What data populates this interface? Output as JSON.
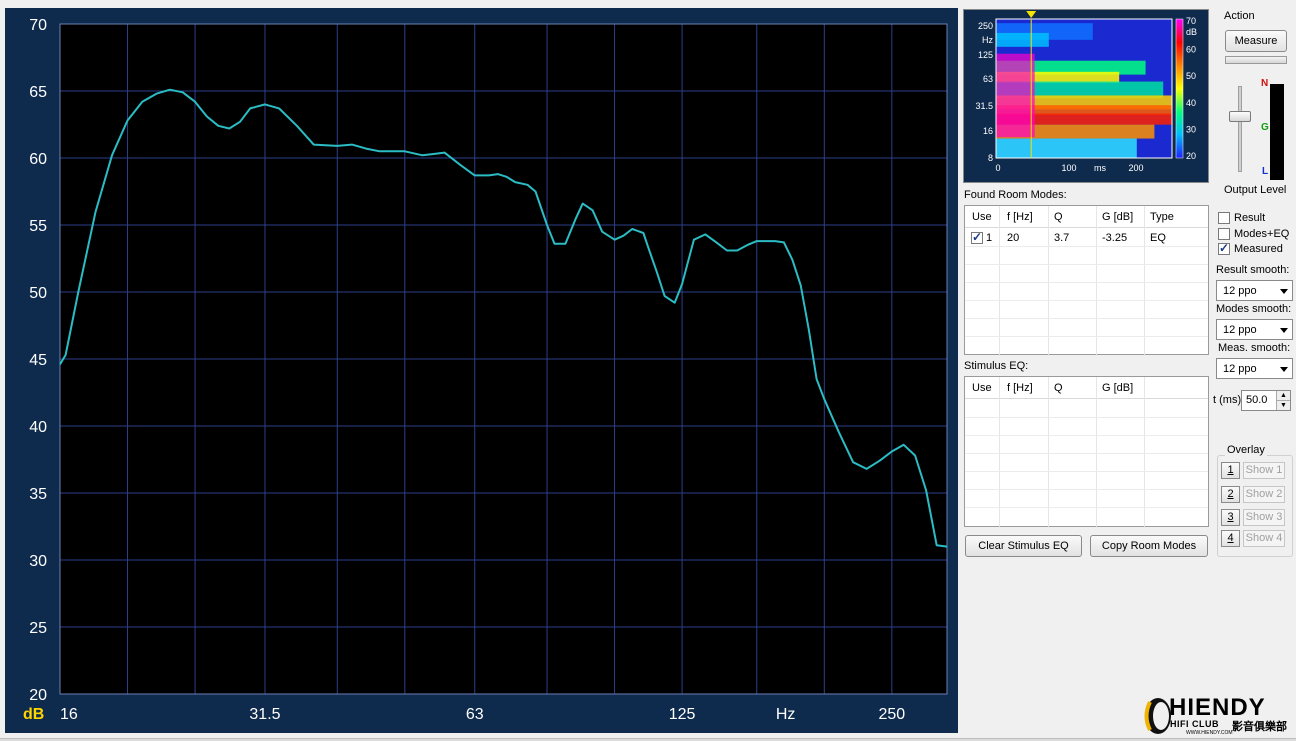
{
  "main_plot": {
    "y_unit_label": "dB",
    "x_unit_label": "Hz",
    "y_tick_labels": [
      "70",
      "65",
      "60",
      "55",
      "50",
      "45",
      "40",
      "35",
      "30",
      "25",
      "20"
    ],
    "x_tick_labels": [
      "16",
      "31.5",
      "63",
      "125",
      "250"
    ],
    "line_color": "#2bbcc4",
    "background_color": "#000000",
    "grid_color": "#2d3f8c"
  },
  "chart_data": {
    "type": "line",
    "xlabel": "Hz",
    "ylabel": "dB",
    "ylim": [
      20,
      70
    ],
    "xlim": [
      16,
      300
    ],
    "x_scale": "log",
    "grid": true,
    "series": [
      {
        "x": [
          16,
          16.3,
          17,
          18,
          19,
          20,
          21,
          22,
          23,
          24,
          25,
          26,
          27,
          28,
          29,
          30,
          31.5,
          33,
          35,
          37,
          40,
          42,
          44,
          46,
          48,
          50,
          53,
          55,
          57,
          60,
          63,
          66,
          68,
          70,
          72,
          75,
          77,
          80,
          82,
          85,
          88,
          90,
          93,
          96,
          100,
          103,
          106,
          110,
          112,
          115,
          118,
          122,
          125,
          130,
          135,
          140,
          145,
          150,
          155,
          160,
          165,
          170,
          175,
          180,
          185,
          190,
          195,
          200,
          210,
          220,
          230,
          240,
          250,
          260,
          270,
          280,
          290,
          300
        ],
        "y": [
          44.6,
          45.3,
          50,
          56,
          60.2,
          62.8,
          64.2,
          64.8,
          65.1,
          64.9,
          64.2,
          63.1,
          62.4,
          62.2,
          62.7,
          63.7,
          64.0,
          63.7,
          62.4,
          61.0,
          60.9,
          61.0,
          60.7,
          60.5,
          60.5,
          60.5,
          60.2,
          60.3,
          60.4,
          59.5,
          58.7,
          58.7,
          58.8,
          58.6,
          58.2,
          58.0,
          57.5,
          55.0,
          53.6,
          53.6,
          55.5,
          56.6,
          56.1,
          54.5,
          53.9,
          54.2,
          54.7,
          54.4,
          53.2,
          51.5,
          49.7,
          49.2,
          50.6,
          53.9,
          54.3,
          53.7,
          53.1,
          53.1,
          53.5,
          53.8,
          53.8,
          53.8,
          53.7,
          52.4,
          50.5,
          47.2,
          43.5,
          42.0,
          39.5,
          37.3,
          36.8,
          37.4,
          38.1,
          38.6,
          37.8,
          35.2,
          31.1,
          31.0
        ]
      }
    ]
  },
  "spectrogram": {
    "y_unit_label": "Hz",
    "y_tick_labels": [
      "250",
      "125",
      "63",
      "31.5",
      "16",
      "8"
    ],
    "x_tick_labels": [
      "0",
      "100",
      "ms",
      "200"
    ],
    "colorbar_unit": "dB",
    "colorbar_tick_labels": [
      "70",
      "60",
      "50",
      "40",
      "30",
      "20"
    ],
    "marker_color": "#f5e400",
    "color_stops": [
      "#2020ff",
      "#00c0ff",
      "#00ff80",
      "#ffff00",
      "#ff8000",
      "#ff0000",
      "#ff00ff"
    ]
  },
  "found_room_modes": {
    "title": "Found Room Modes:",
    "columns": [
      "Use",
      "f [Hz]",
      "Q",
      "G [dB]",
      "Type"
    ],
    "rows": [
      {
        "use": true,
        "index": "1",
        "f": "20",
        "q": "3.7",
        "g": "-3.25",
        "type": "EQ"
      }
    ]
  },
  "stimulus_eq": {
    "title": "Stimulus EQ:",
    "columns": [
      "Use",
      "f [Hz]",
      "Q",
      "G [dB]"
    ]
  },
  "buttons": {
    "clear_stimulus_eq": "Clear Stimulus EQ",
    "copy_room_modes": "Copy Room Modes",
    "measure": "Measure"
  },
  "action": {
    "group_label": "Action",
    "output_level_label": "Output Level",
    "meter_letters": [
      "N",
      "G",
      "L"
    ],
    "meter_colors": [
      "#d01010",
      "#10a010",
      "#1030d0"
    ]
  },
  "display_options": {
    "result": {
      "label": "Result",
      "checked": false
    },
    "modes_eq": {
      "label": "Modes+EQ",
      "checked": false
    },
    "measured": {
      "label": "Measured",
      "checked": true
    }
  },
  "smoothing": {
    "result_label": "Result smooth:",
    "result_value": "12 ppo",
    "modes_label": "Modes smooth:",
    "modes_value": "12 ppo",
    "meas_label": "Meas. smooth:",
    "meas_value": "12 ppo"
  },
  "time_window": {
    "label": "t (ms)",
    "value": "50.0"
  },
  "overlay": {
    "group_label": "Overlay",
    "items": [
      {
        "num": "1",
        "label": "Show 1"
      },
      {
        "num": "2",
        "label": "Show 2"
      },
      {
        "num": "3",
        "label": "Show 3"
      },
      {
        "num": "4",
        "label": "Show 4"
      }
    ]
  },
  "logo": {
    "brand": "HIENDY",
    "subline": "HIFI CLUB",
    "url_text": "WWW.HIENDY.COM",
    "cjk_text": "影音俱樂部"
  }
}
